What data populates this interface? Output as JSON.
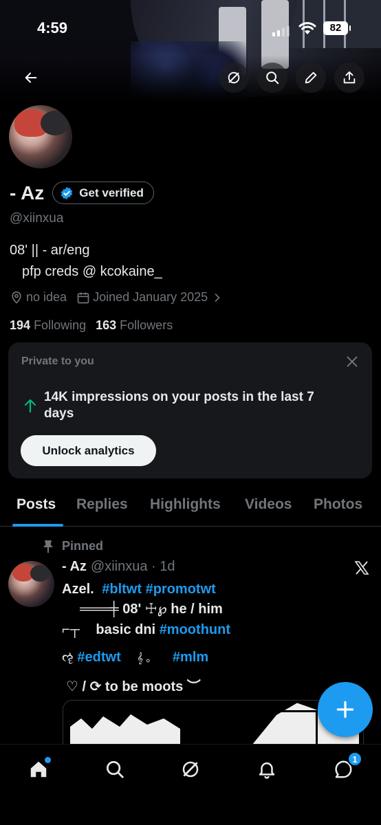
{
  "status_bar": {
    "time": "4:59",
    "battery": "82"
  },
  "profile": {
    "display_name": "- Az",
    "get_verified_label": "Get verified",
    "handle": "@xiinxua",
    "bio_line1": "08' || - ar/eng",
    "bio_line2": "pfp creds @ kcokaine_",
    "location": "no idea",
    "joined": "Joined January 2025",
    "following_count": "194",
    "following_label": "Following",
    "followers_count": "163",
    "followers_label": "Followers"
  },
  "analytics_card": {
    "title": "Private to you",
    "impressions_text": "14K impressions on your posts in the last 7 days",
    "unlock_label": "Unlock analytics"
  },
  "tabs": [
    {
      "label": "Posts",
      "active": true
    },
    {
      "label": "Replies"
    },
    {
      "label": "Highlights"
    },
    {
      "label": "Videos"
    },
    {
      "label": "Photos"
    }
  ],
  "post": {
    "pinned_label": "Pinned",
    "name": "- Az",
    "handle_time": "@xiinxua · 1d",
    "line1_text": "Azel.",
    "line1_tag1": "#bltwt",
    "line1_tag2": "#promotwt",
    "line2_text": "═══╪ 08' ☩℘  he / him",
    "line3_sym": "⌐┬",
    "line3_text": "basic dni",
    "line3_tag": "#moothunt",
    "line4_sym1": "ૡ",
    "line4_tag1": "#edtwt",
    "line4_sym2": "𝄞 。",
    "line4_tag2": "#mlm",
    "line5_text": "♡  /  ⟳  to be moots  ︶"
  },
  "nav": {
    "messages_badge": "1"
  },
  "colors": {
    "accent": "#1d9bf0",
    "muted": "#71767b",
    "text": "#e7e9ea",
    "card": "#16181c"
  }
}
